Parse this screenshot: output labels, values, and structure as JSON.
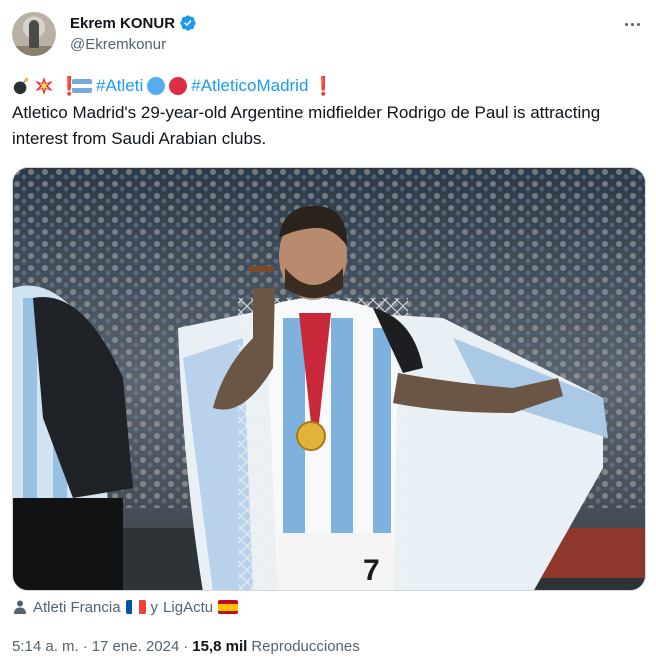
{
  "author": {
    "display_name": "Ekrem KONUR",
    "handle": "@Ekremkonur",
    "verified_icon": "verified-badge-icon",
    "avatar": "avatar-photo"
  },
  "tweet": {
    "hashtags": [
      "#Atleti",
      "#AtleticoMadrid"
    ],
    "exclamation": "❗",
    "text": "Atletico Madrid's 29-year-old Argentine midfielder Rodrigo de Paul is attracting interest from Saudi Arabian clubs."
  },
  "media": {
    "description": "photo",
    "shirt_number": "7"
  },
  "source_line": {
    "icon": "person-icon",
    "text_a": "Atleti Francia",
    "joiner": "y",
    "text_b": "LigActu"
  },
  "meta": {
    "time": "5:14 a. m.",
    "separator": "·",
    "date": "17 ene. 2024",
    "views_count": "15,8 mil",
    "views_label": "Reproducciones"
  },
  "colors": {
    "link": "#1d9bf0",
    "secondary_text": "#536471",
    "primary_text": "#0f1419",
    "verified": "#1d9bf0"
  }
}
